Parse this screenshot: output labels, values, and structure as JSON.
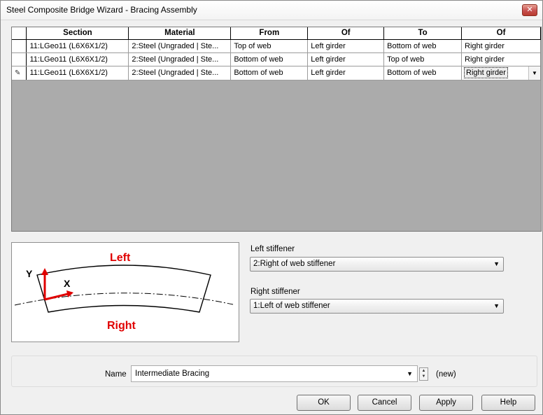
{
  "window": {
    "title": "Steel Composite Bridge Wizard - Bracing Assembly",
    "close_glyph": "✕"
  },
  "grid": {
    "columns": [
      "Section",
      "Material",
      "From",
      "Of",
      "To",
      "Of"
    ],
    "rows": [
      {
        "section": "11:LGeo11 (L6X6X1/2)",
        "material": "2:Steel (Ungraded | Ste...",
        "from": "Top of web",
        "of1": "Left girder",
        "to": "Bottom of web",
        "of2": "Right girder"
      },
      {
        "section": "11:LGeo11 (L6X6X1/2)",
        "material": "2:Steel (Ungraded | Ste...",
        "from": "Bottom of web",
        "of1": "Left girder",
        "to": "Top of web",
        "of2": "Right girder"
      },
      {
        "section": "11:LGeo11 (L6X6X1/2)",
        "material": "2:Steel (Ungraded | Ste...",
        "from": "Bottom of web",
        "of1": "Left girder",
        "to": "Bottom of web",
        "of2": "Right girder"
      }
    ]
  },
  "diagram": {
    "left_label": "Left",
    "right_label": "Right",
    "y_label": "Y",
    "x_label": "X",
    "accent_color": "#e00000"
  },
  "stiffeners": {
    "left_label": "Left stiffener",
    "left_value": "2:Right of web stiffener",
    "right_label": "Right stiffener",
    "right_value": "1:Left of web stiffener"
  },
  "name_field": {
    "label": "Name",
    "value": "Intermediate Bracing",
    "status": "(new)"
  },
  "buttons": {
    "ok": "OK",
    "cancel": "Cancel",
    "apply": "Apply",
    "help": "Help"
  }
}
